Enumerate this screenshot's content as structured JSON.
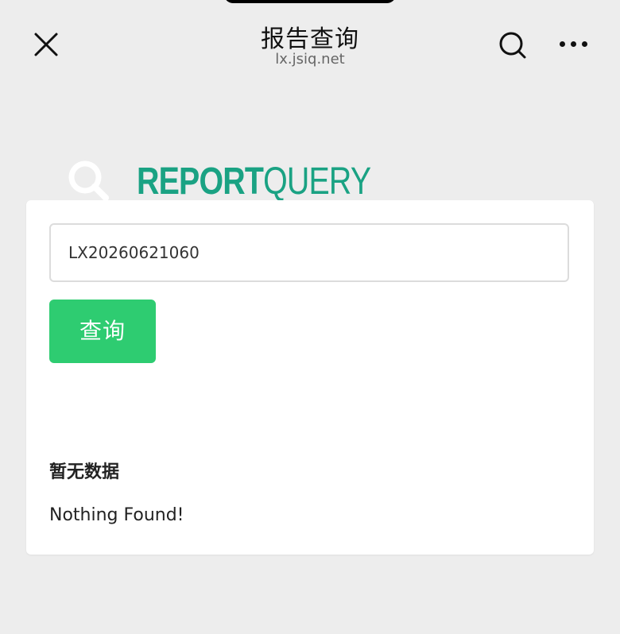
{
  "header": {
    "title": "报告查询",
    "domain": "lx.jsiq.net",
    "icons": {
      "close": "close-icon",
      "search": "search-icon",
      "more": "more-dots-icon"
    }
  },
  "logo": {
    "icon": "magnifier-icon",
    "bold_text": "REPORT",
    "light_text": "QUERY",
    "color": "#1aa283"
  },
  "form": {
    "input_value": "LX20260621060",
    "button_label": "查询",
    "button_color": "#2ecc71"
  },
  "result": {
    "title": "暂无数据",
    "message": "Nothing Found!"
  }
}
